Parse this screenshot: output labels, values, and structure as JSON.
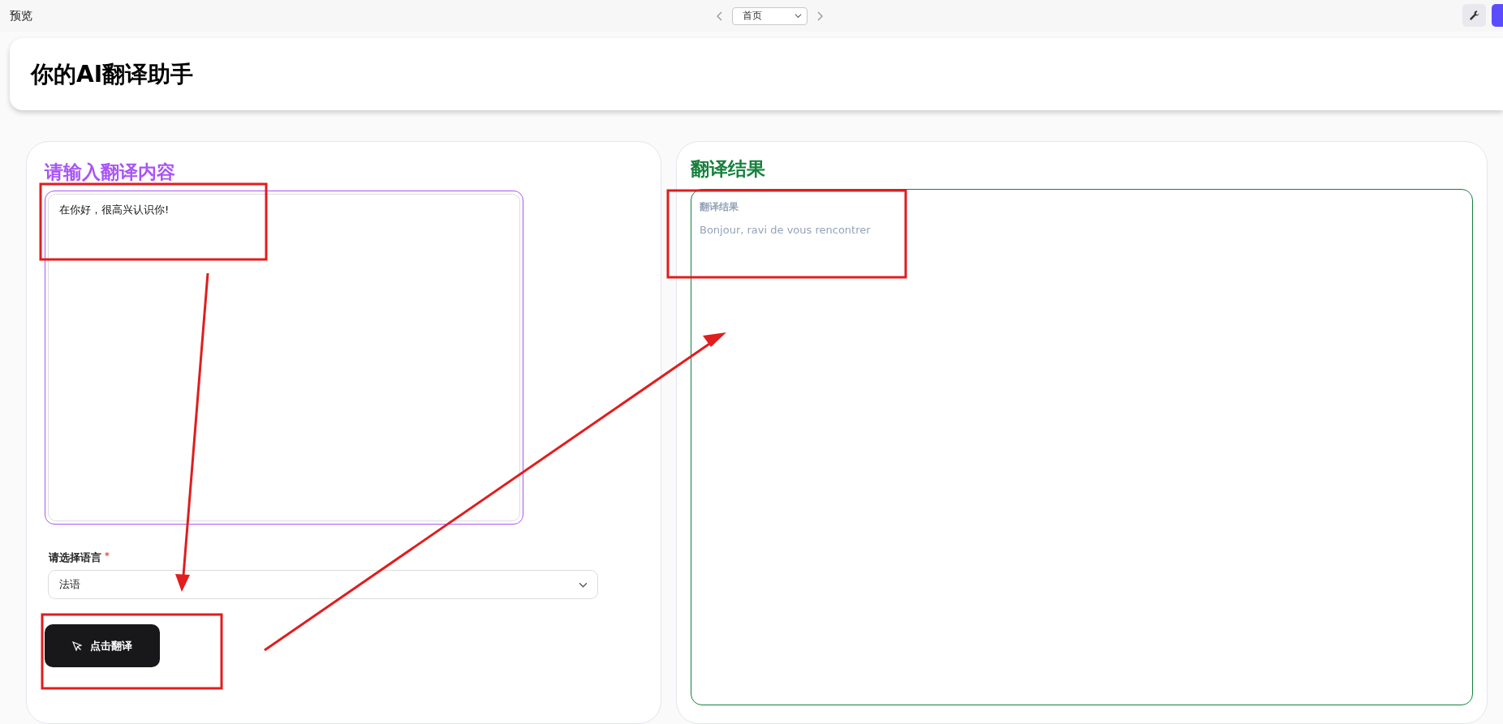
{
  "topbar": {
    "title": "预览",
    "page_select": "首页"
  },
  "header": {
    "title": "你的AI翻译助手"
  },
  "input_panel": {
    "title": "请输入翻译内容",
    "text": "在你好，很高兴认识你!",
    "language": {
      "label": "请选择语言",
      "required_mark": "*",
      "value": "法语"
    },
    "button": "点击翻译"
  },
  "result_panel": {
    "title": "翻译结果",
    "field_label": "翻译结果",
    "output": "Bonjour, ravi de vous rencontrer"
  }
}
